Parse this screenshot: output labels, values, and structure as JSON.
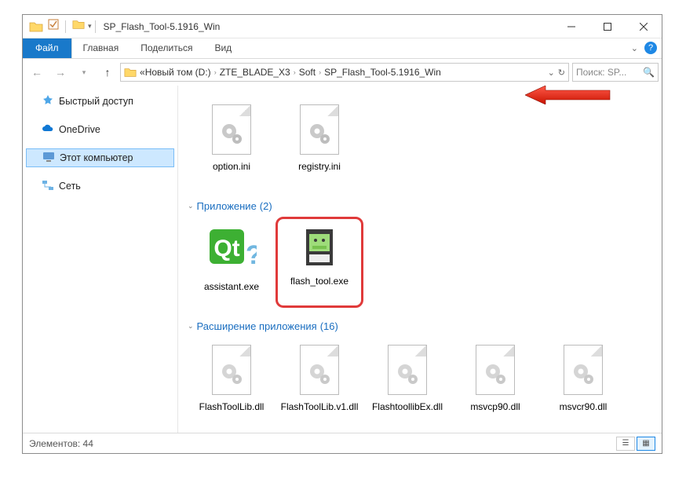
{
  "title": "SP_Flash_Tool-5.1916_Win",
  "ribbon": {
    "file": "Файл",
    "home": "Главная",
    "share": "Поделиться",
    "view": "Вид"
  },
  "breadcrumb": {
    "prefix": "«",
    "items": [
      "Новый том (D:)",
      "ZTE_BLADE_X3",
      "Soft",
      "SP_Flash_Tool-5.1916_Win"
    ]
  },
  "search_placeholder": "Поиск: SP...",
  "sidebar": {
    "quick": "Быстрый доступ",
    "onedrive": "OneDrive",
    "thispc": "Этот компьютер",
    "network": "Сеть"
  },
  "groups": [
    {
      "name_top_hidden": true,
      "items": [
        {
          "label": "option.ini",
          "type": "ini"
        },
        {
          "label": "registry.ini",
          "type": "ini"
        }
      ]
    },
    {
      "header": "Приложение",
      "count": "(2)",
      "items": [
        {
          "label": "assistant.exe",
          "type": "qt"
        },
        {
          "label": "flash_tool.exe",
          "type": "flashtool",
          "highlighted": true
        }
      ]
    },
    {
      "header": "Расширение приложения",
      "count": "(16)",
      "items": [
        {
          "label": "FlashToolLib.dll",
          "type": "dll"
        },
        {
          "label": "FlashToolLib.v1.dll",
          "type": "dll"
        },
        {
          "label": "FlashtoollibEx.dll",
          "type": "dll"
        },
        {
          "label": "msvcp90.dll",
          "type": "dll"
        },
        {
          "label": "msvcr90.dll",
          "type": "dll"
        }
      ]
    }
  ],
  "status": "Элементов: 44"
}
